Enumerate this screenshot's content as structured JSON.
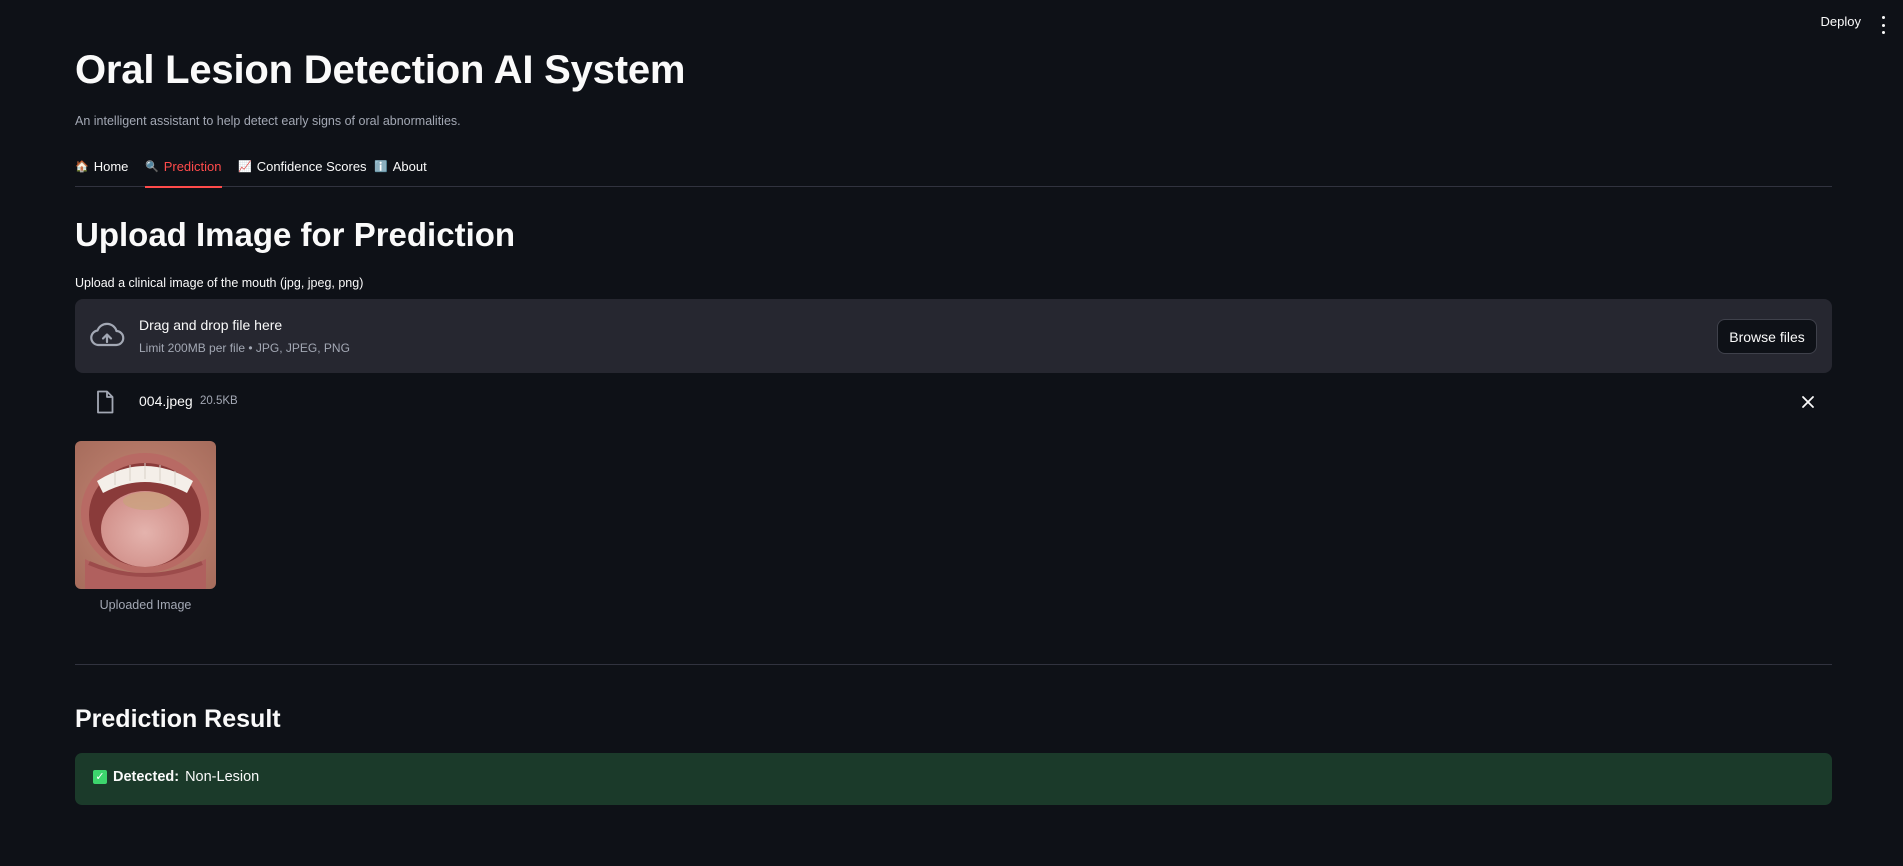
{
  "header": {
    "deploy_label": "Deploy",
    "menu_icon": "kebab-menu-icon"
  },
  "app": {
    "title": "Oral Lesion Detection AI System",
    "subtitle": "An intelligent assistant to help detect early signs of oral abnormalities."
  },
  "tabs": [
    {
      "icon": "🏠",
      "label": "Home",
      "active": false
    },
    {
      "icon": "🔍",
      "label": "Prediction",
      "active": true
    },
    {
      "icon": "📈",
      "label": "Confidence Scores",
      "active": false
    },
    {
      "icon": "ℹ️",
      "label": "About",
      "active": false
    }
  ],
  "upload": {
    "heading": "Upload Image for Prediction",
    "label": "Upload a clinical image of the mouth (jpg, jpeg, png)",
    "drop_text": "Drag and drop file here",
    "limit_text": "Limit 200MB per file • JPG, JPEG, PNG",
    "browse_label": "Browse files",
    "icon": "cloud-upload-icon"
  },
  "file": {
    "name": "004.jpeg",
    "size": "20.5KB",
    "icon": "file-icon",
    "remove_icon": "close-icon"
  },
  "image": {
    "caption": "Uploaded Image"
  },
  "result": {
    "heading": "Prediction Result",
    "label": "Detected:",
    "value": "Non-Lesion",
    "icon": "check-icon"
  },
  "colors": {
    "background": "#0e1117",
    "accent": "#ff4b4b",
    "success_bg": "#1b3a2a",
    "secondary_bg": "#262730"
  }
}
